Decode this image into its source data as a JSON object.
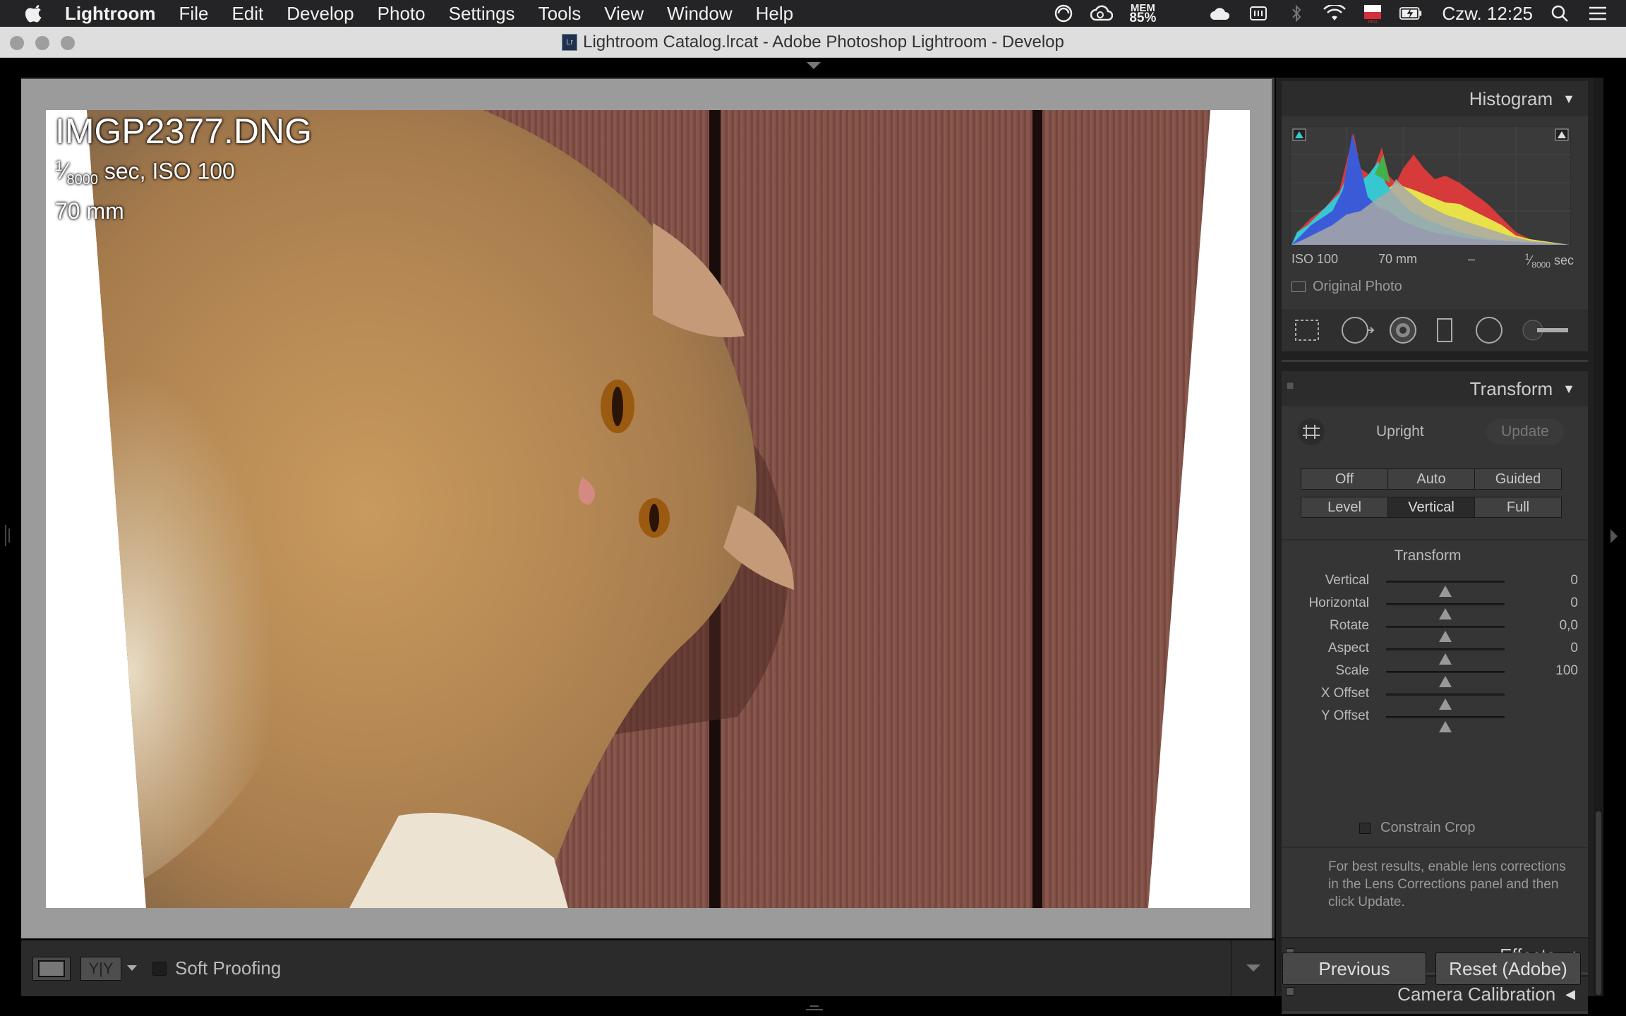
{
  "menubar": {
    "app": "Lightroom",
    "items": [
      "File",
      "Edit",
      "Develop",
      "Photo",
      "Settings",
      "Tools",
      "View",
      "Window",
      "Help"
    ],
    "mem_label": "MEM",
    "mem_value": "85%",
    "clock": "Czw. 12:25",
    "status_icons": [
      "sync-icon",
      "creative-cloud-icon",
      "memory-icon",
      "cloud-icon",
      "keyboard-icon",
      "bluetooth-icon",
      "wifi-icon",
      "flag-icon",
      "battery-icon",
      "search-icon",
      "list-icon"
    ]
  },
  "window": {
    "title": "Lightroom Catalog.lrcat - Adobe Photoshop Lightroom - Develop",
    "doc_icon": "Lr"
  },
  "photo": {
    "filename": "IMGP2377.DNG",
    "shutter_num": "1",
    "shutter_den": "8000",
    "shutter_rest": " sec, ISO 100",
    "focal": "70 mm"
  },
  "toolbar": {
    "soft_proofing": "Soft Proofing",
    "soft_proofing_checked": false
  },
  "histogram": {
    "title": "Histogram",
    "iso": "ISO 100",
    "focal": "70 mm",
    "aperture": "–",
    "shutter_num": "1",
    "shutter_den": "8000",
    "shutter_unit": " sec",
    "original_photo": "Original Photo"
  },
  "tools": [
    "crop-overlay-icon",
    "spot-removal-icon",
    "red-eye-icon",
    "graduated-filter-icon",
    "radial-filter-icon",
    "adjustment-brush-icon"
  ],
  "transform": {
    "title": "Transform",
    "upright": "Upright",
    "update": "Update",
    "row1": [
      "Off",
      "Auto",
      "Guided"
    ],
    "row2": [
      "Level",
      "Vertical",
      "Full"
    ],
    "selected": "Vertical",
    "section_title": "Transform",
    "sliders": [
      {
        "label": "Vertical",
        "value": "0"
      },
      {
        "label": "Horizontal",
        "value": "0"
      },
      {
        "label": "Rotate",
        "value": "0,0"
      },
      {
        "label": "Aspect",
        "value": "0"
      },
      {
        "label": "Scale",
        "value": "100"
      },
      {
        "label": "X Offset",
        "value": ""
      },
      {
        "label": "Y Offset",
        "value": ""
      }
    ],
    "constrain_crop": "Constrain Crop",
    "note": "For best results, enable lens corrections in the Lens Corrections panel and then click Update."
  },
  "effects": {
    "title": "Effects"
  },
  "calibration": {
    "title": "Camera Calibration"
  },
  "buttons": {
    "previous": "Previous",
    "reset": "Reset (Adobe)"
  }
}
